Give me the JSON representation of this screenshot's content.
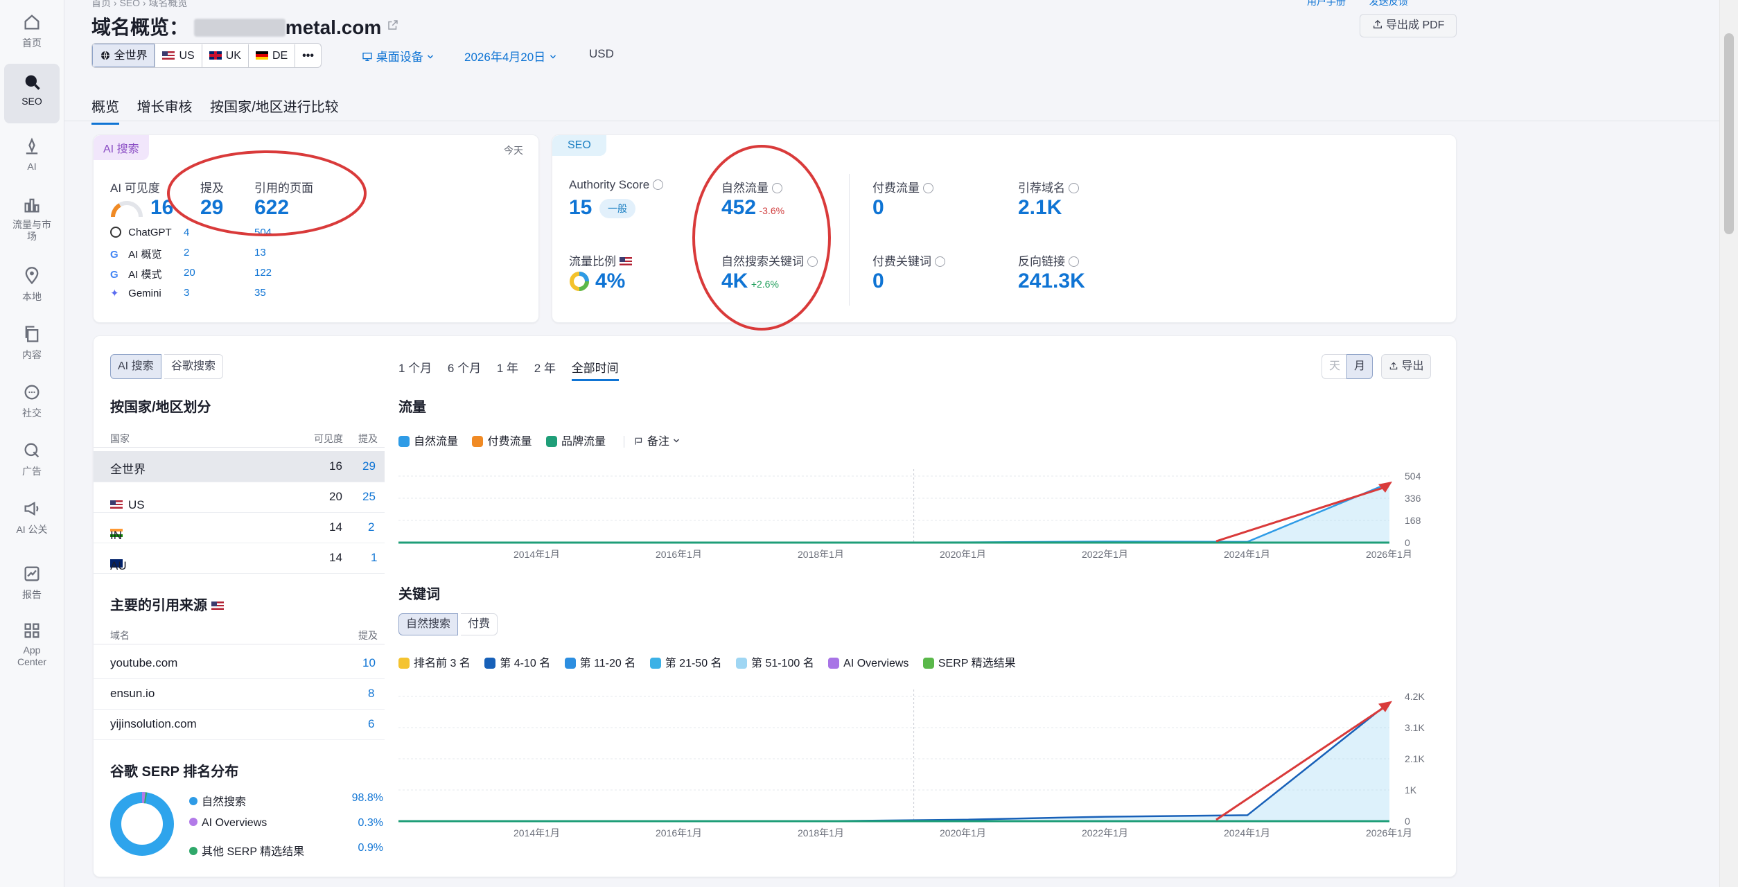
{
  "sidebar": [
    {
      "label": "首页",
      "icon": "home-icon"
    },
    {
      "label": "SEO",
      "icon": "seo-icon",
      "active": true
    },
    {
      "label": "AI",
      "icon": "ai-icon"
    },
    {
      "label": "流量与市场",
      "icon": "chart-icon"
    },
    {
      "label": "本地",
      "icon": "map-pin-icon"
    },
    {
      "label": "内容",
      "icon": "content-icon"
    },
    {
      "label": "社交",
      "icon": "chat-icon"
    },
    {
      "label": "广告",
      "icon": "ads-icon"
    },
    {
      "label": "AI 公关",
      "icon": "megaphone-icon"
    },
    {
      "label": "报告",
      "icon": "report-icon"
    },
    {
      "label": "App Center",
      "icon": "grid-icon"
    }
  ],
  "header": {
    "breadcrumb": [
      "首页",
      "SEO",
      "域名概览"
    ],
    "title_prefix": "域名概览：",
    "domain": "metal.com",
    "export_pdf": "导出成 PDF",
    "top_right_links": [
      "用户手册",
      "发送反馈"
    ],
    "region_buttons": [
      "全世界",
      "US",
      "UK",
      "DE",
      "•••"
    ],
    "device": "桌面设备",
    "date": "2026年4月20日",
    "currency": "USD",
    "tabs": [
      "概览",
      "增长审核",
      "按国家/地区进行比较"
    ]
  },
  "ai_card": {
    "badge": "AI 搜索",
    "today": "今天",
    "visibility_label": "AI 可见度",
    "visibility_value": "16",
    "mentions_label": "提及",
    "mentions_value": "29",
    "pages_label": "引用的页面",
    "pages_value": "622",
    "sources": [
      {
        "name": "ChatGPT",
        "mentions": "4",
        "pages": "504"
      },
      {
        "name": "AI 概览",
        "mentions": "2",
        "pages": "13"
      },
      {
        "name": "AI 模式",
        "mentions": "20",
        "pages": "122"
      },
      {
        "name": "Gemini",
        "mentions": "3",
        "pages": "35"
      }
    ]
  },
  "seo_card": {
    "badge": "SEO",
    "authority_label": "Authority Score",
    "authority_value": "15",
    "authority_tag": "一般",
    "organic_label": "自然流量",
    "organic_value": "452",
    "organic_delta": "-3.6%",
    "paid_label": "付费流量",
    "paid_value": "0",
    "refdomains_label": "引荐域名",
    "refdomains_value": "2.1K",
    "share_label": "流量比例",
    "share_value": "4%",
    "kw_label": "自然搜索关键词",
    "kw_value": "4K",
    "kw_delta": "+2.6%",
    "paidkw_label": "付费关键词",
    "paidkw_value": "0",
    "backlinks_label": "反向链接",
    "backlinks_value": "241.3K"
  },
  "lower": {
    "search_tabs": [
      "AI 搜索",
      "谷歌搜索"
    ],
    "periods": [
      "1 个月",
      "6 个月",
      "1 年",
      "2 年",
      "全部时间"
    ],
    "granularity": [
      "天",
      "月"
    ],
    "export": "导出",
    "country_title": "按国家/地区划分",
    "country_headers": [
      "国家",
      "可见度",
      "提及"
    ],
    "countries": [
      {
        "name": "全世界",
        "visibility": "16",
        "mentions": "29"
      },
      {
        "name": "US",
        "visibility": "20",
        "mentions": "25"
      },
      {
        "name": "IN",
        "visibility": "14",
        "mentions": "2"
      },
      {
        "name": "AU",
        "visibility": "14",
        "mentions": "1"
      }
    ],
    "sources_title": "主要的引用来源",
    "sources_headers": [
      "域名",
      "提及"
    ],
    "sources": [
      {
        "domain": "youtube.com",
        "mentions": "10"
      },
      {
        "domain": "ensun.io",
        "mentions": "8"
      },
      {
        "domain": "yijinsolution.com",
        "mentions": "6"
      }
    ],
    "serp_title": "谷歌 SERP 排名分布",
    "serp": [
      {
        "label": "自然搜索",
        "value": "98.8%",
        "color": "#2e9be6"
      },
      {
        "label": "AI Overviews",
        "value": "0.3%",
        "color": "#b27ae8"
      },
      {
        "label": "其他 SERP 精选结果",
        "value": "0.9%",
        "color": "#2fa86a"
      }
    ],
    "traffic_title": "流量",
    "traffic_legend": [
      {
        "label": "自然流量",
        "color": "#2e9be6"
      },
      {
        "label": "付费流量",
        "color": "#f08a24"
      },
      {
        "label": "品牌流量",
        "color": "#1f9e78"
      }
    ],
    "notes": "备注",
    "keywords_title": "关键词",
    "kw_tabs": [
      "自然搜索",
      "付费"
    ],
    "kw_legend": [
      {
        "label": "排名前 3 名",
        "color": "#f4c330"
      },
      {
        "label": "第 4-10 名",
        "color": "#1760b8"
      },
      {
        "label": "第 11-20 名",
        "color": "#2c8ee0"
      },
      {
        "label": "第 21-50 名",
        "color": "#3cb1e6"
      },
      {
        "label": "第 51-100 名",
        "color": "#9fd6f3"
      },
      {
        "label": "AI Overviews",
        "color": "#a874e6"
      },
      {
        "label": "SERP 精选结果",
        "color": "#5ab84a"
      }
    ]
  },
  "chart_data": [
    {
      "type": "area",
      "title": "流量",
      "x": [
        "2014年1月",
        "2016年1月",
        "2018年1月",
        "2020年1月",
        "2022年1月",
        "2024年1月",
        "2026年1月"
      ],
      "y_ticks": [
        "0",
        "168",
        "336",
        "504"
      ],
      "ylim": [
        0,
        504
      ],
      "series": [
        {
          "name": "自然流量",
          "values": [
            0,
            0,
            0,
            2,
            8,
            6,
            452
          ]
        }
      ]
    },
    {
      "type": "area",
      "title": "关键词",
      "x": [
        "2014年1月",
        "2016年1月",
        "2018年1月",
        "2020年1月",
        "2022年1月",
        "2024年1月",
        "2026年1月"
      ],
      "y_ticks": [
        "0",
        "1K",
        "2.1K",
        "3.1K",
        "4.2K"
      ],
      "ylim": [
        0,
        4200
      ],
      "series": [
        {
          "name": "自然搜索",
          "values": [
            0,
            0,
            0,
            50,
            150,
            200,
            4000
          ]
        }
      ]
    }
  ]
}
